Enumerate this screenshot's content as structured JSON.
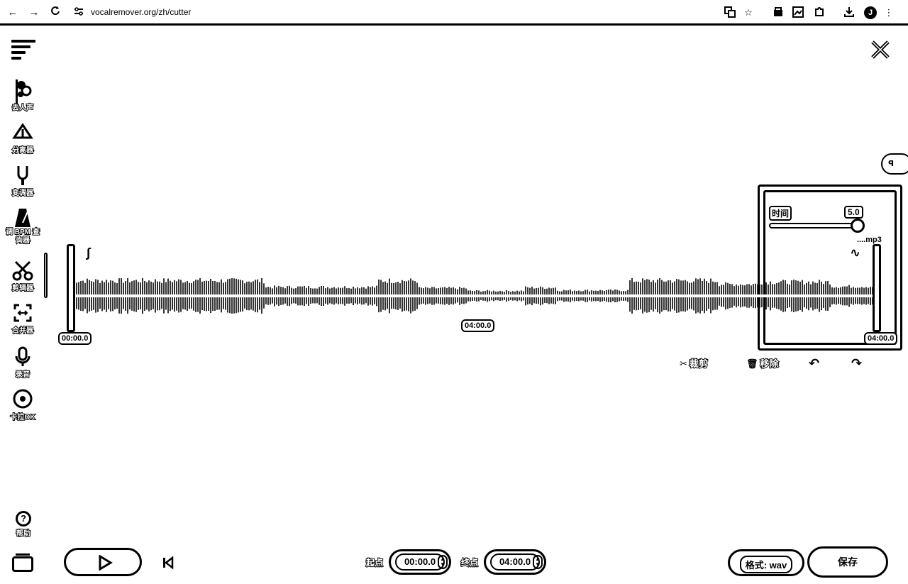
{
  "browser": {
    "url": "vocalremover.org/zh/cutter",
    "back": "←",
    "forward": "→",
    "reload": "C",
    "profile": "J"
  },
  "sidebar": {
    "items": [
      {
        "label": "去人声",
        "icon": "microphone-remove-icon"
      },
      {
        "label": "分离器",
        "icon": "splitter-icon"
      },
      {
        "label": "变调器",
        "icon": "tuning-fork-icon"
      },
      {
        "label": "调 BPM 查询器",
        "icon": "metronome-icon"
      },
      {
        "label": "剪辑器",
        "icon": "scissors-icon"
      },
      {
        "label": "合并器",
        "icon": "merge-icon"
      },
      {
        "label": "录音",
        "icon": "mic-icon"
      },
      {
        "label": "卡拉OK",
        "icon": "disc-icon"
      }
    ],
    "help": "帮助"
  },
  "waveform": {
    "start_label": "00:00.0",
    "center_label": "04:00.0",
    "end_label": "04:00.0",
    "file_label": "....mp3"
  },
  "speed_panel": {
    "label": "时间",
    "value": "5.0",
    "slider_fraction": 1.0
  },
  "actions": {
    "cut": "裁剪",
    "remove": "移除"
  },
  "bottom": {
    "start_label": "起点",
    "start_value": "00:00.0",
    "end_label": "终点",
    "end_value": "04:00.0",
    "format": "格式: wav",
    "save": "保存"
  },
  "edge_tab": "ꟼ"
}
